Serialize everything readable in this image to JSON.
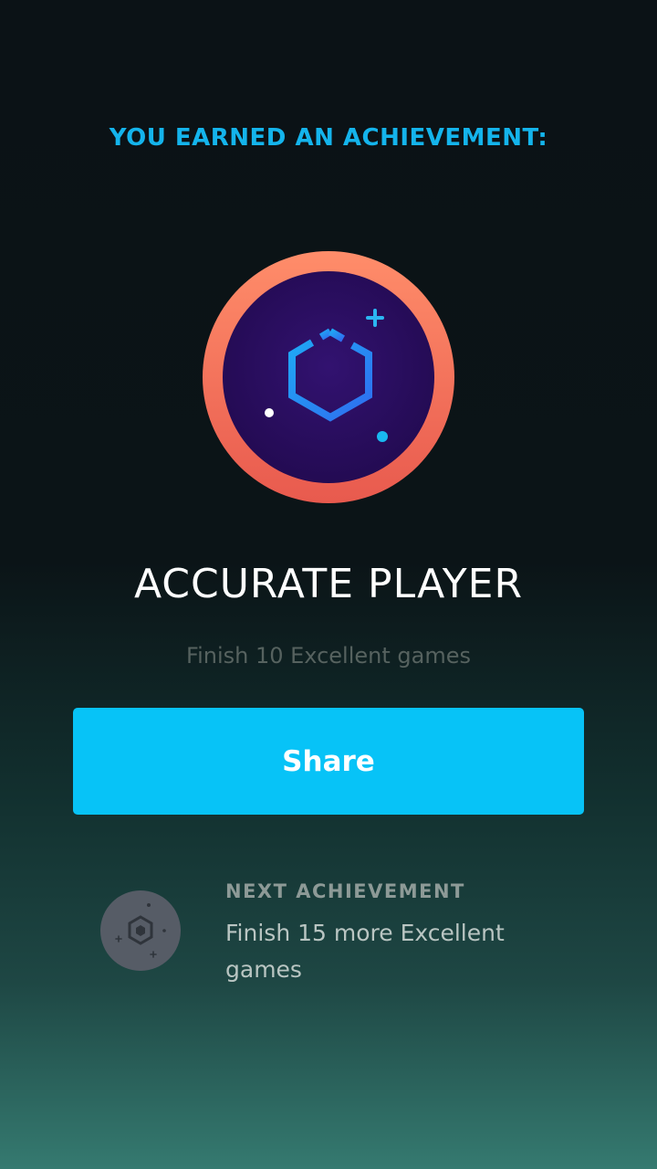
{
  "header": {
    "earned_text": "YOU EARNED AN ACHIEVEMENT:"
  },
  "achievement": {
    "badge_icon": "hexagon-badge-icon",
    "title": "ACCURATE PLAYER",
    "description": "Finish 10 Excellent games"
  },
  "share_button": {
    "label": "Share"
  },
  "next_achievement": {
    "badge_icon": "locked-hexagon-badge-icon",
    "label": "NEXT ACHIEVEMENT",
    "description": "Finish 15 more Excellent games"
  },
  "colors": {
    "accent": "#07c3f7",
    "heading": "#14b4ec",
    "badge_ring": "#f07a5c",
    "badge_inner": "#2a0f5c"
  }
}
